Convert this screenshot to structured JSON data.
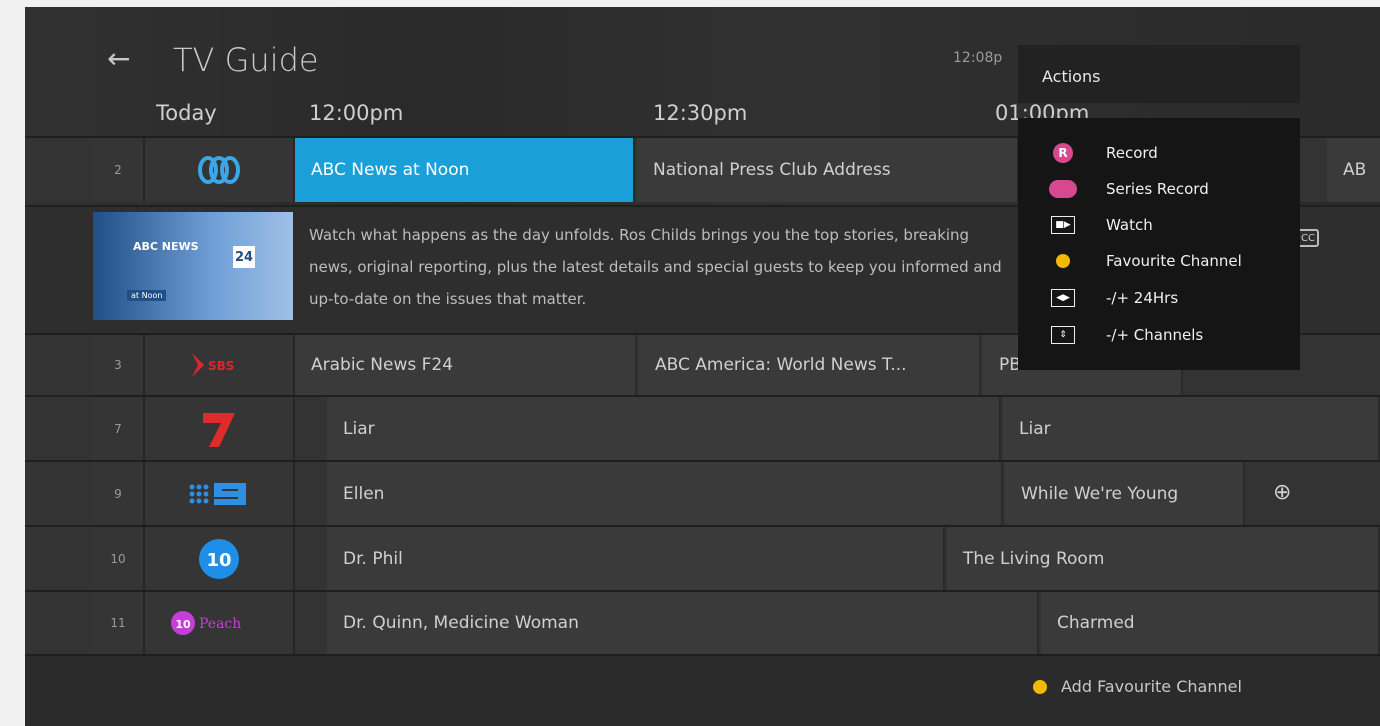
{
  "header": {
    "title": "TV Guide",
    "clock": "12:08p",
    "back_icon": "arrow-left-icon",
    "day": "Today",
    "times": [
      "12:00pm",
      "12:30pm",
      "01:00pm"
    ]
  },
  "rows": [
    {
      "num": "2",
      "channel": "ABC",
      "cells": [
        "ABC News at Noon",
        "National Press Club Address",
        "AB"
      ]
    },
    {
      "num": "3",
      "channel": "SBS",
      "cells": [
        "Arabic News F24",
        "ABC America: World News T...",
        "PBS NewsHour"
      ]
    },
    {
      "num": "7",
      "channel": "7",
      "cells": [
        "Liar",
        "Liar"
      ]
    },
    {
      "num": "9",
      "channel": "9",
      "cells": [
        "Ellen",
        "While We're Young"
      ]
    },
    {
      "num": "10",
      "channel": "10",
      "cells": [
        "Dr. Phil",
        "The Living Room"
      ]
    },
    {
      "num": "11",
      "channel": "10 Peach",
      "cells": [
        "Dr. Quinn, Medicine Woman",
        "Charmed"
      ]
    }
  ],
  "detail": {
    "description": "Watch what happens as the day unfolds. Ros Childs brings you the top stories, breaking news, original reporting, plus the latest details and special guests to keep you informed and up-to-date on the issues that matter.",
    "thumb_brand": "ABC NEWS",
    "thumb_channel": "24",
    "thumb_sub": "at Noon",
    "cc": "CC"
  },
  "actions": {
    "title": "Actions",
    "items": [
      {
        "label": "Record",
        "icon": "record-icon",
        "color": "#d7488e"
      },
      {
        "label": "Series Record",
        "icon": "series-record-icon",
        "color": "#d7488e"
      },
      {
        "label": "Watch",
        "icon": "watch-icon"
      },
      {
        "label": "Favourite Channel",
        "icon": "favourite-dot-icon",
        "color": "#f2b800"
      },
      {
        "label": "-/+ 24Hrs",
        "icon": "ff-rew-icon"
      },
      {
        "label": "-/+ Channels",
        "icon": "channel-up-down-icon"
      }
    ]
  },
  "footer": {
    "label": "Add Favourite Channel",
    "color": "#f2b800"
  },
  "colors": {
    "selected": "#1a9fd8"
  }
}
